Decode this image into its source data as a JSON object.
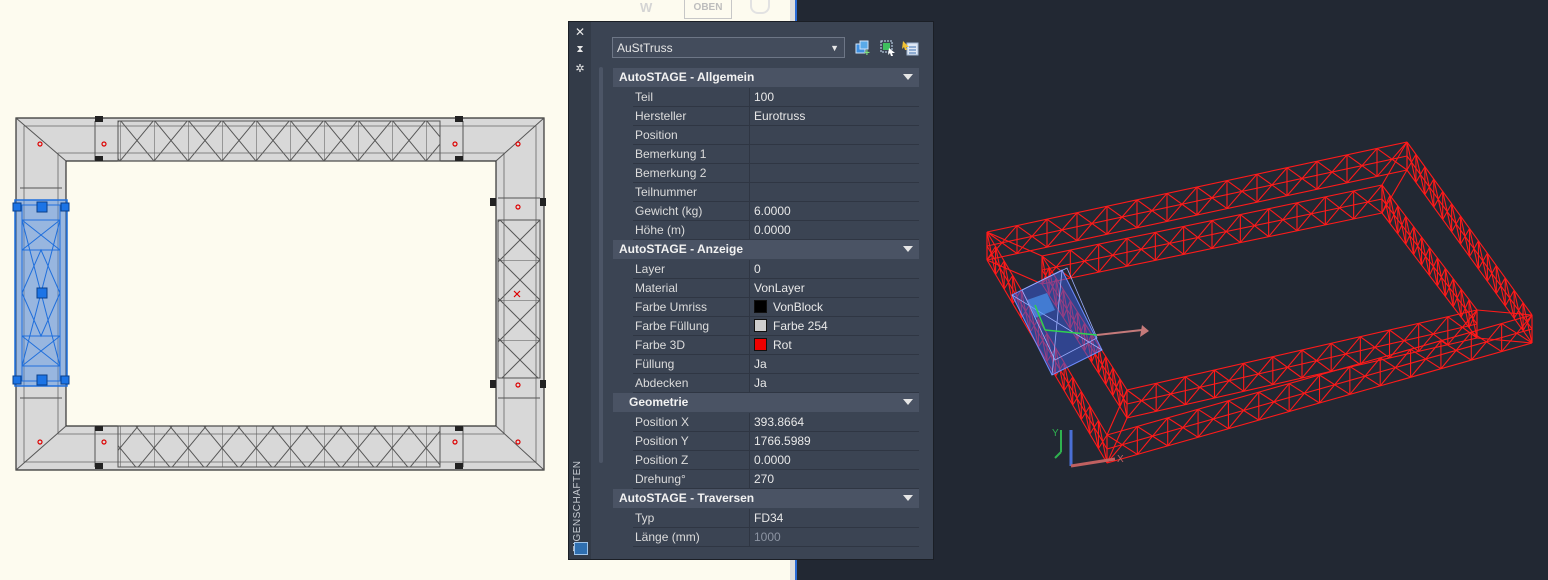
{
  "viewcube": {
    "left_letter": "W",
    "label": "OBEN"
  },
  "palette": {
    "vertical_title": "EIGENSCHAFTEN",
    "object_select": "AuStTruss",
    "sections": [
      {
        "title": "AutoSTAGE - Allgemein",
        "rows": [
          {
            "name": "Teil",
            "value": "100"
          },
          {
            "name": "Hersteller",
            "value": "Eurotruss"
          },
          {
            "name": "Position",
            "value": ""
          },
          {
            "name": "Bemerkung 1",
            "value": ""
          },
          {
            "name": "Bemerkung 2",
            "value": ""
          },
          {
            "name": "Teilnummer",
            "value": ""
          },
          {
            "name": "Gewicht (kg)",
            "value": "6.0000"
          },
          {
            "name": "Höhe (m)",
            "value": "0.0000"
          }
        ]
      },
      {
        "title": "AutoSTAGE - Anzeige",
        "rows": [
          {
            "name": "Layer",
            "value": "0"
          },
          {
            "name": "Material",
            "value": "VonLayer"
          },
          {
            "name": "Farbe Umriss",
            "value": "VonBlock",
            "swatch": "#000000"
          },
          {
            "name": "Farbe Füllung",
            "value": "Farbe 254",
            "swatch": "#cfcfcf"
          },
          {
            "name": "Farbe 3D",
            "value": "Rot",
            "swatch": "#ee0000"
          },
          {
            "name": "Füllung",
            "value": "Ja"
          },
          {
            "name": "Abdecken",
            "value": "Ja"
          }
        ]
      },
      {
        "title": "Geometrie",
        "rows": [
          {
            "name": "Position X",
            "value": "393.8664"
          },
          {
            "name": "Position Y",
            "value": "1766.5989"
          },
          {
            "name": "Position Z",
            "value": "0.0000"
          },
          {
            "name": "Drehung°",
            "value": "270"
          }
        ]
      },
      {
        "title": "AutoSTAGE - Traversen",
        "rows": [
          {
            "name": "Typ",
            "value": "FD34"
          },
          {
            "name": "Länge (mm)",
            "value": "1000",
            "dim": true
          }
        ]
      }
    ]
  },
  "colors": {
    "model_bg": "#fdfbef",
    "viewport_3d_bg": "#222833",
    "truss_fill": "#d8d8d8",
    "selection": "#2f7fe0",
    "truss_3d": "#ff1a1a",
    "palette_bg": "#3b4453"
  }
}
